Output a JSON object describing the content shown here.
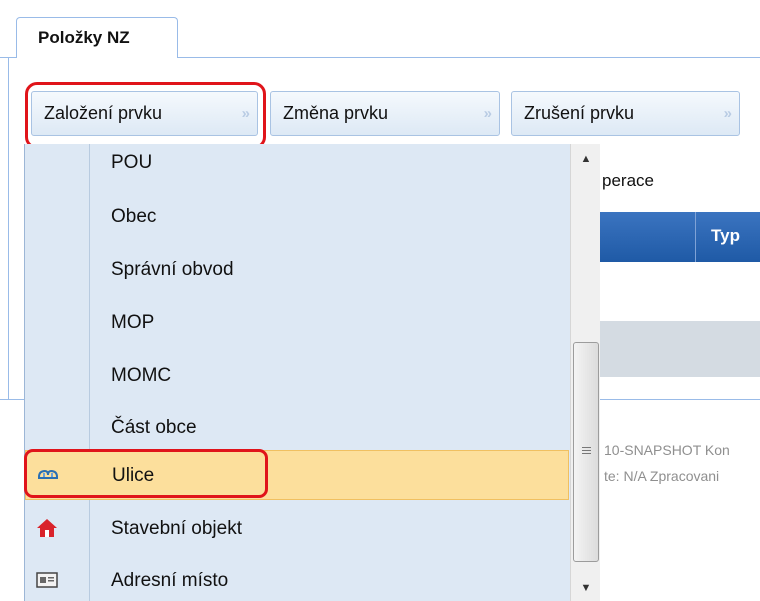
{
  "tab": {
    "label": "Položky NZ"
  },
  "toolbar": {
    "create_label": "Založení prvku",
    "change_label": "Změna prvku",
    "cancel_label": "Zrušení prvku",
    "chevron": "»"
  },
  "background": {
    "operation_text": "perace",
    "column_header": "Typ",
    "footer_line1": "10-SNAPSHOT Kon",
    "footer_line2": "te: N/A Zpracovani"
  },
  "menu": {
    "items": [
      {
        "label": "POU",
        "icon": ""
      },
      {
        "label": "Obec",
        "icon": ""
      },
      {
        "label": "Správní obvod",
        "icon": ""
      },
      {
        "label": "MOP",
        "icon": ""
      },
      {
        "label": "MOMC",
        "icon": ""
      },
      {
        "label": "Část obce",
        "icon": ""
      },
      {
        "label": "Ulice",
        "icon": "street-icon"
      },
      {
        "label": "Stavební objekt",
        "icon": "house-icon"
      },
      {
        "label": "Adresní místo",
        "icon": "address-card-icon"
      }
    ],
    "scroll_up": "▲",
    "scroll_down": "▼"
  },
  "colors": {
    "accent_blue": "#99bbe8",
    "highlight_red": "#e0141a",
    "active_item": "#fcdf9c"
  }
}
